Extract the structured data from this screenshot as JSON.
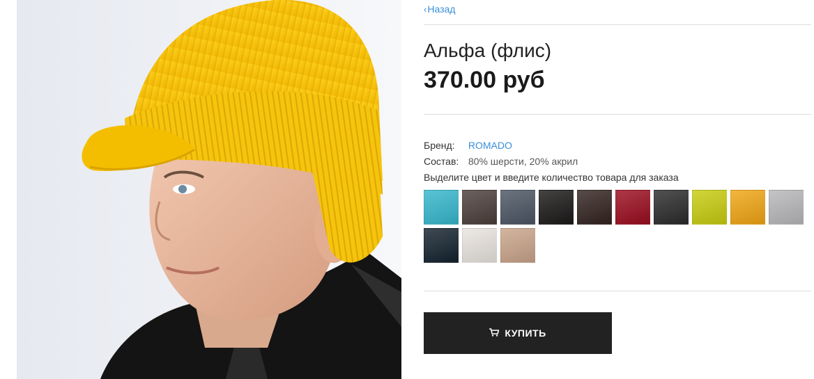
{
  "nav": {
    "back_label": "Назад"
  },
  "product": {
    "title": "Альфа (флис)",
    "price": "370.00 руб",
    "image_alt": "yellow-knit-cap-with-visor-photo"
  },
  "specs": {
    "brand_label": "Бренд:",
    "brand_value": "ROMADO",
    "composition_label": "Состав:",
    "composition_value": "80% шерсти, 20% акрил"
  },
  "color_hint": "Выделите цвет и введите количество товара для заказа",
  "swatches": [
    {
      "name": "turquoise",
      "color": "#35b7cc"
    },
    {
      "name": "dark-brown-gray",
      "color": "#4b3e3a"
    },
    {
      "name": "slate-gray",
      "color": "#4b5563"
    },
    {
      "name": "black",
      "color": "#1b1918"
    },
    {
      "name": "dark-chocolate",
      "color": "#33241f"
    },
    {
      "name": "burgundy",
      "color": "#9a0d1f"
    },
    {
      "name": "charcoal",
      "color": "#2c2b2b"
    },
    {
      "name": "lime",
      "color": "#c7cc0f"
    },
    {
      "name": "orange-yellow",
      "color": "#f0a514"
    },
    {
      "name": "light-gray",
      "color": "#b7b7ba"
    },
    {
      "name": "navy-black",
      "color": "#14222e"
    },
    {
      "name": "off-white",
      "color": "#e8e3df"
    },
    {
      "name": "beige",
      "color": "#c9a48a"
    }
  ],
  "buy_button": {
    "label": "КУПИТЬ",
    "icon": "cart-icon"
  }
}
